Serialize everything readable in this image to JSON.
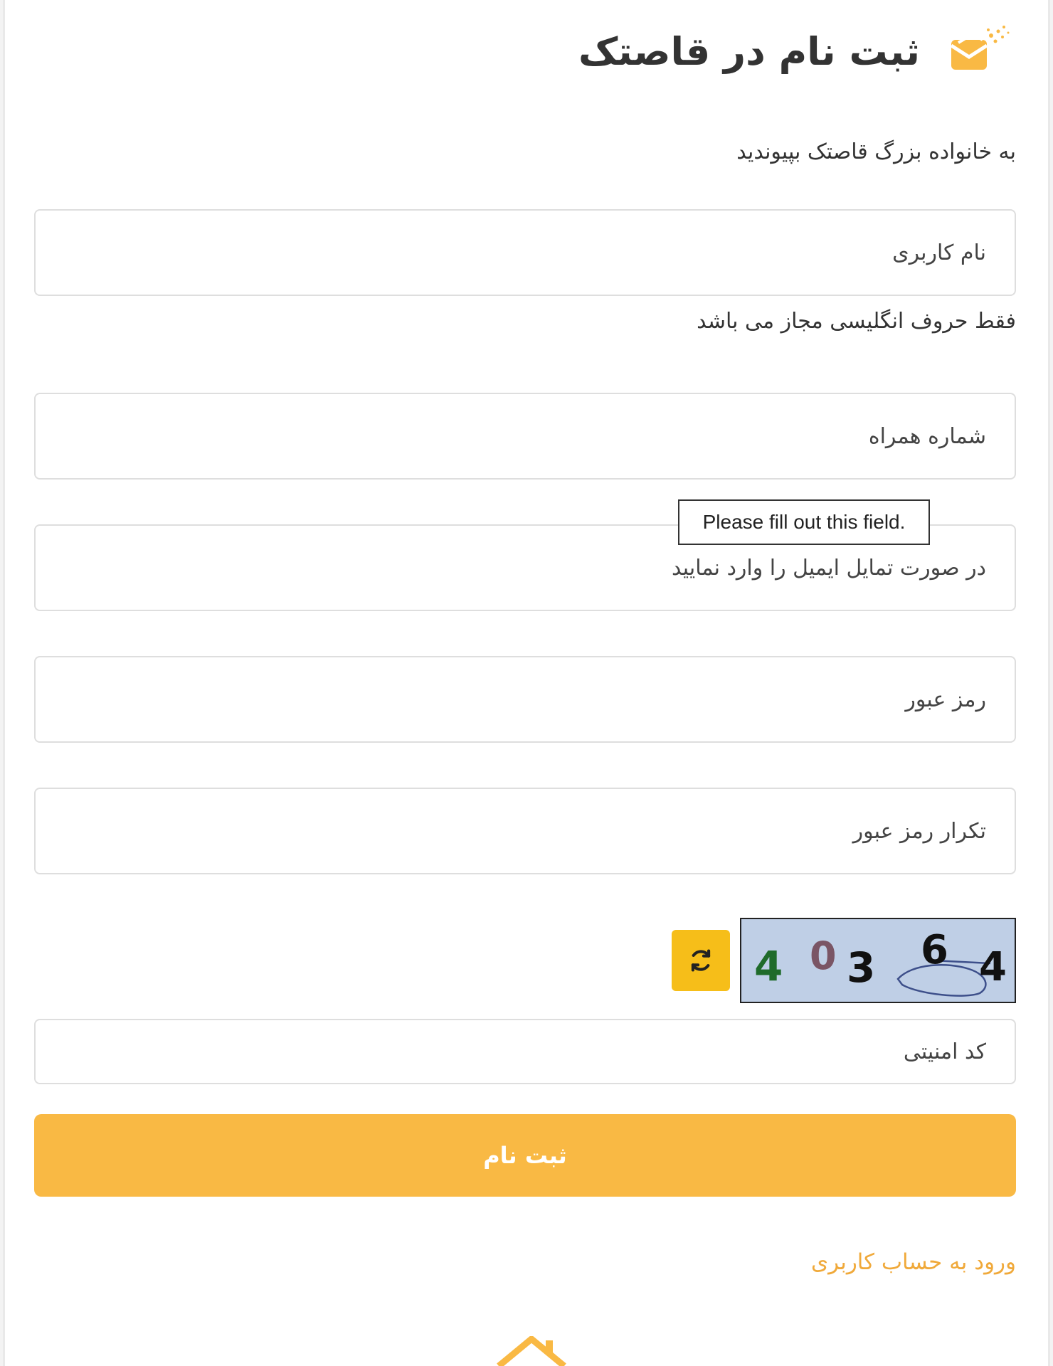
{
  "header": {
    "title": "ثبت نام در قاصتک",
    "logo_icon": "mail-envelope-icon"
  },
  "subtitle": "به خانواده بزرگ قاصتک بپیوندید",
  "form": {
    "username_placeholder": "نام کاربری",
    "username_hint": "فقط حروف انگلیسی مجاز می باشد",
    "phone_placeholder": "شماره همراه",
    "email_placeholder": "در صورت تمایل ایمیل را وارد نمایید",
    "password_placeholder": "رمز عبور",
    "password_confirm_placeholder": "تکرار رمز عبور",
    "captcha_placeholder": "کد امنیتی",
    "submit_label": "ثبت نام"
  },
  "validation_tooltip": "Please fill out this field.",
  "captcha": {
    "digits": [
      "4",
      "0",
      "3",
      "6",
      "4"
    ],
    "refresh_icon": "refresh-icon"
  },
  "login_link": "ورود به حساب کاربری",
  "colors": {
    "accent": "#f9b944",
    "refresh_button": "#f6be19",
    "link": "#f0a93a",
    "captcha_bg": "#bfcfe6"
  }
}
